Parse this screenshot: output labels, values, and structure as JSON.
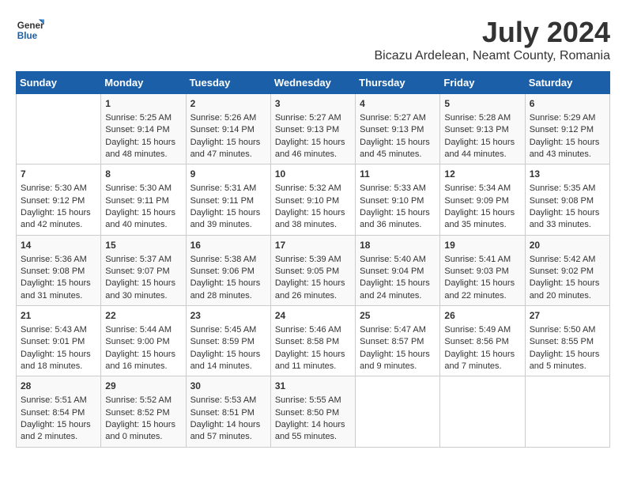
{
  "header": {
    "logo_text_general": "General",
    "logo_text_blue": "Blue",
    "month_title": "July 2024",
    "subtitle": "Bicazu Ardelean, Neamt County, Romania"
  },
  "days_of_week": [
    "Sunday",
    "Monday",
    "Tuesday",
    "Wednesday",
    "Thursday",
    "Friday",
    "Saturday"
  ],
  "weeks": [
    [
      {
        "day": "",
        "lines": []
      },
      {
        "day": "1",
        "lines": [
          "Sunrise: 5:25 AM",
          "Sunset: 9:14 PM",
          "Daylight: 15 hours",
          "and 48 minutes."
        ]
      },
      {
        "day": "2",
        "lines": [
          "Sunrise: 5:26 AM",
          "Sunset: 9:14 PM",
          "Daylight: 15 hours",
          "and 47 minutes."
        ]
      },
      {
        "day": "3",
        "lines": [
          "Sunrise: 5:27 AM",
          "Sunset: 9:13 PM",
          "Daylight: 15 hours",
          "and 46 minutes."
        ]
      },
      {
        "day": "4",
        "lines": [
          "Sunrise: 5:27 AM",
          "Sunset: 9:13 PM",
          "Daylight: 15 hours",
          "and 45 minutes."
        ]
      },
      {
        "day": "5",
        "lines": [
          "Sunrise: 5:28 AM",
          "Sunset: 9:13 PM",
          "Daylight: 15 hours",
          "and 44 minutes."
        ]
      },
      {
        "day": "6",
        "lines": [
          "Sunrise: 5:29 AM",
          "Sunset: 9:12 PM",
          "Daylight: 15 hours",
          "and 43 minutes."
        ]
      }
    ],
    [
      {
        "day": "7",
        "lines": [
          "Sunrise: 5:30 AM",
          "Sunset: 9:12 PM",
          "Daylight: 15 hours",
          "and 42 minutes."
        ]
      },
      {
        "day": "8",
        "lines": [
          "Sunrise: 5:30 AM",
          "Sunset: 9:11 PM",
          "Daylight: 15 hours",
          "and 40 minutes."
        ]
      },
      {
        "day": "9",
        "lines": [
          "Sunrise: 5:31 AM",
          "Sunset: 9:11 PM",
          "Daylight: 15 hours",
          "and 39 minutes."
        ]
      },
      {
        "day": "10",
        "lines": [
          "Sunrise: 5:32 AM",
          "Sunset: 9:10 PM",
          "Daylight: 15 hours",
          "and 38 minutes."
        ]
      },
      {
        "day": "11",
        "lines": [
          "Sunrise: 5:33 AM",
          "Sunset: 9:10 PM",
          "Daylight: 15 hours",
          "and 36 minutes."
        ]
      },
      {
        "day": "12",
        "lines": [
          "Sunrise: 5:34 AM",
          "Sunset: 9:09 PM",
          "Daylight: 15 hours",
          "and 35 minutes."
        ]
      },
      {
        "day": "13",
        "lines": [
          "Sunrise: 5:35 AM",
          "Sunset: 9:08 PM",
          "Daylight: 15 hours",
          "and 33 minutes."
        ]
      }
    ],
    [
      {
        "day": "14",
        "lines": [
          "Sunrise: 5:36 AM",
          "Sunset: 9:08 PM",
          "Daylight: 15 hours",
          "and 31 minutes."
        ]
      },
      {
        "day": "15",
        "lines": [
          "Sunrise: 5:37 AM",
          "Sunset: 9:07 PM",
          "Daylight: 15 hours",
          "and 30 minutes."
        ]
      },
      {
        "day": "16",
        "lines": [
          "Sunrise: 5:38 AM",
          "Sunset: 9:06 PM",
          "Daylight: 15 hours",
          "and 28 minutes."
        ]
      },
      {
        "day": "17",
        "lines": [
          "Sunrise: 5:39 AM",
          "Sunset: 9:05 PM",
          "Daylight: 15 hours",
          "and 26 minutes."
        ]
      },
      {
        "day": "18",
        "lines": [
          "Sunrise: 5:40 AM",
          "Sunset: 9:04 PM",
          "Daylight: 15 hours",
          "and 24 minutes."
        ]
      },
      {
        "day": "19",
        "lines": [
          "Sunrise: 5:41 AM",
          "Sunset: 9:03 PM",
          "Daylight: 15 hours",
          "and 22 minutes."
        ]
      },
      {
        "day": "20",
        "lines": [
          "Sunrise: 5:42 AM",
          "Sunset: 9:02 PM",
          "Daylight: 15 hours",
          "and 20 minutes."
        ]
      }
    ],
    [
      {
        "day": "21",
        "lines": [
          "Sunrise: 5:43 AM",
          "Sunset: 9:01 PM",
          "Daylight: 15 hours",
          "and 18 minutes."
        ]
      },
      {
        "day": "22",
        "lines": [
          "Sunrise: 5:44 AM",
          "Sunset: 9:00 PM",
          "Daylight: 15 hours",
          "and 16 minutes."
        ]
      },
      {
        "day": "23",
        "lines": [
          "Sunrise: 5:45 AM",
          "Sunset: 8:59 PM",
          "Daylight: 15 hours",
          "and 14 minutes."
        ]
      },
      {
        "day": "24",
        "lines": [
          "Sunrise: 5:46 AM",
          "Sunset: 8:58 PM",
          "Daylight: 15 hours",
          "and 11 minutes."
        ]
      },
      {
        "day": "25",
        "lines": [
          "Sunrise: 5:47 AM",
          "Sunset: 8:57 PM",
          "Daylight: 15 hours",
          "and 9 minutes."
        ]
      },
      {
        "day": "26",
        "lines": [
          "Sunrise: 5:49 AM",
          "Sunset: 8:56 PM",
          "Daylight: 15 hours",
          "and 7 minutes."
        ]
      },
      {
        "day": "27",
        "lines": [
          "Sunrise: 5:50 AM",
          "Sunset: 8:55 PM",
          "Daylight: 15 hours",
          "and 5 minutes."
        ]
      }
    ],
    [
      {
        "day": "28",
        "lines": [
          "Sunrise: 5:51 AM",
          "Sunset: 8:54 PM",
          "Daylight: 15 hours",
          "and 2 minutes."
        ]
      },
      {
        "day": "29",
        "lines": [
          "Sunrise: 5:52 AM",
          "Sunset: 8:52 PM",
          "Daylight: 15 hours",
          "and 0 minutes."
        ]
      },
      {
        "day": "30",
        "lines": [
          "Sunrise: 5:53 AM",
          "Sunset: 8:51 PM",
          "Daylight: 14 hours",
          "and 57 minutes."
        ]
      },
      {
        "day": "31",
        "lines": [
          "Sunrise: 5:55 AM",
          "Sunset: 8:50 PM",
          "Daylight: 14 hours",
          "and 55 minutes."
        ]
      },
      {
        "day": "",
        "lines": []
      },
      {
        "day": "",
        "lines": []
      },
      {
        "day": "",
        "lines": []
      }
    ]
  ]
}
